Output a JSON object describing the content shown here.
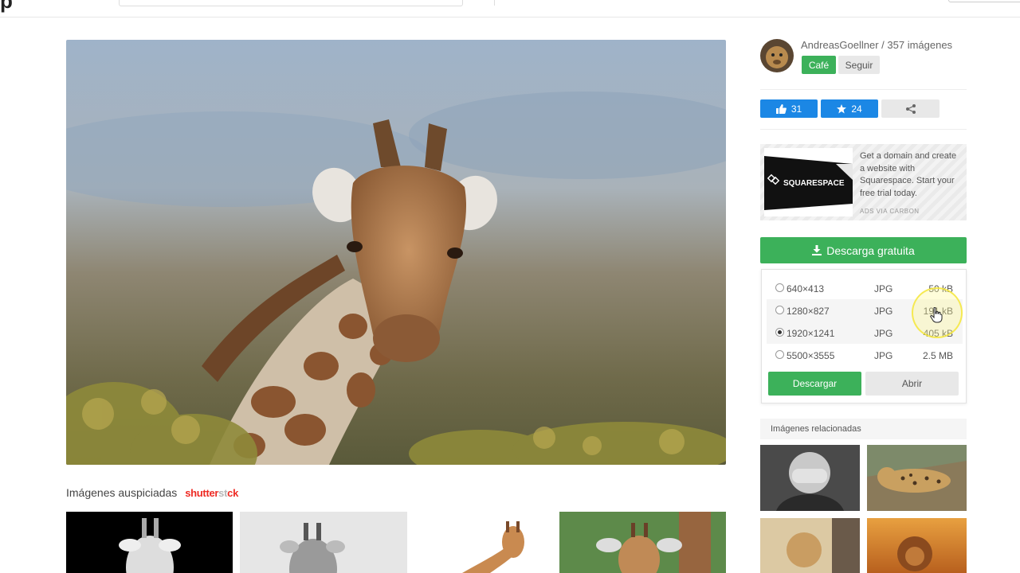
{
  "author": {
    "line": "AndreasGoellner / 357 imágenes",
    "cafe_label": "Café",
    "follow_label": "Seguir"
  },
  "social": {
    "likes": "31",
    "favorites": "24"
  },
  "ad": {
    "brand": "SQUARESPACE",
    "text": "Get a domain and create a website with Squarespace. Start your free trial today.",
    "via": "ADS VIA CARBON"
  },
  "download": {
    "main_label": "Descarga gratuita",
    "options": [
      {
        "size": "640×413",
        "format": "JPG",
        "filesize": "50 kB"
      },
      {
        "size": "1280×827",
        "format": "JPG",
        "filesize": "191 kB"
      },
      {
        "size": "1920×1241",
        "format": "JPG",
        "filesize": "405 kB"
      },
      {
        "size": "5500×3555",
        "format": "JPG",
        "filesize": "2.5 MB"
      }
    ],
    "selected_index": 2,
    "download_label": "Descargar",
    "open_label": "Abrir"
  },
  "sponsored": {
    "label": "Imágenes auspiciadas",
    "brand_a": "shutter",
    "brand_b": "st",
    "brand_c": "ck"
  },
  "related": {
    "title": "Imágenes relacionadas"
  },
  "colors": {
    "green": "#3cb15a",
    "blue": "#1b87e5",
    "grey_button": "#e8e8e8"
  }
}
